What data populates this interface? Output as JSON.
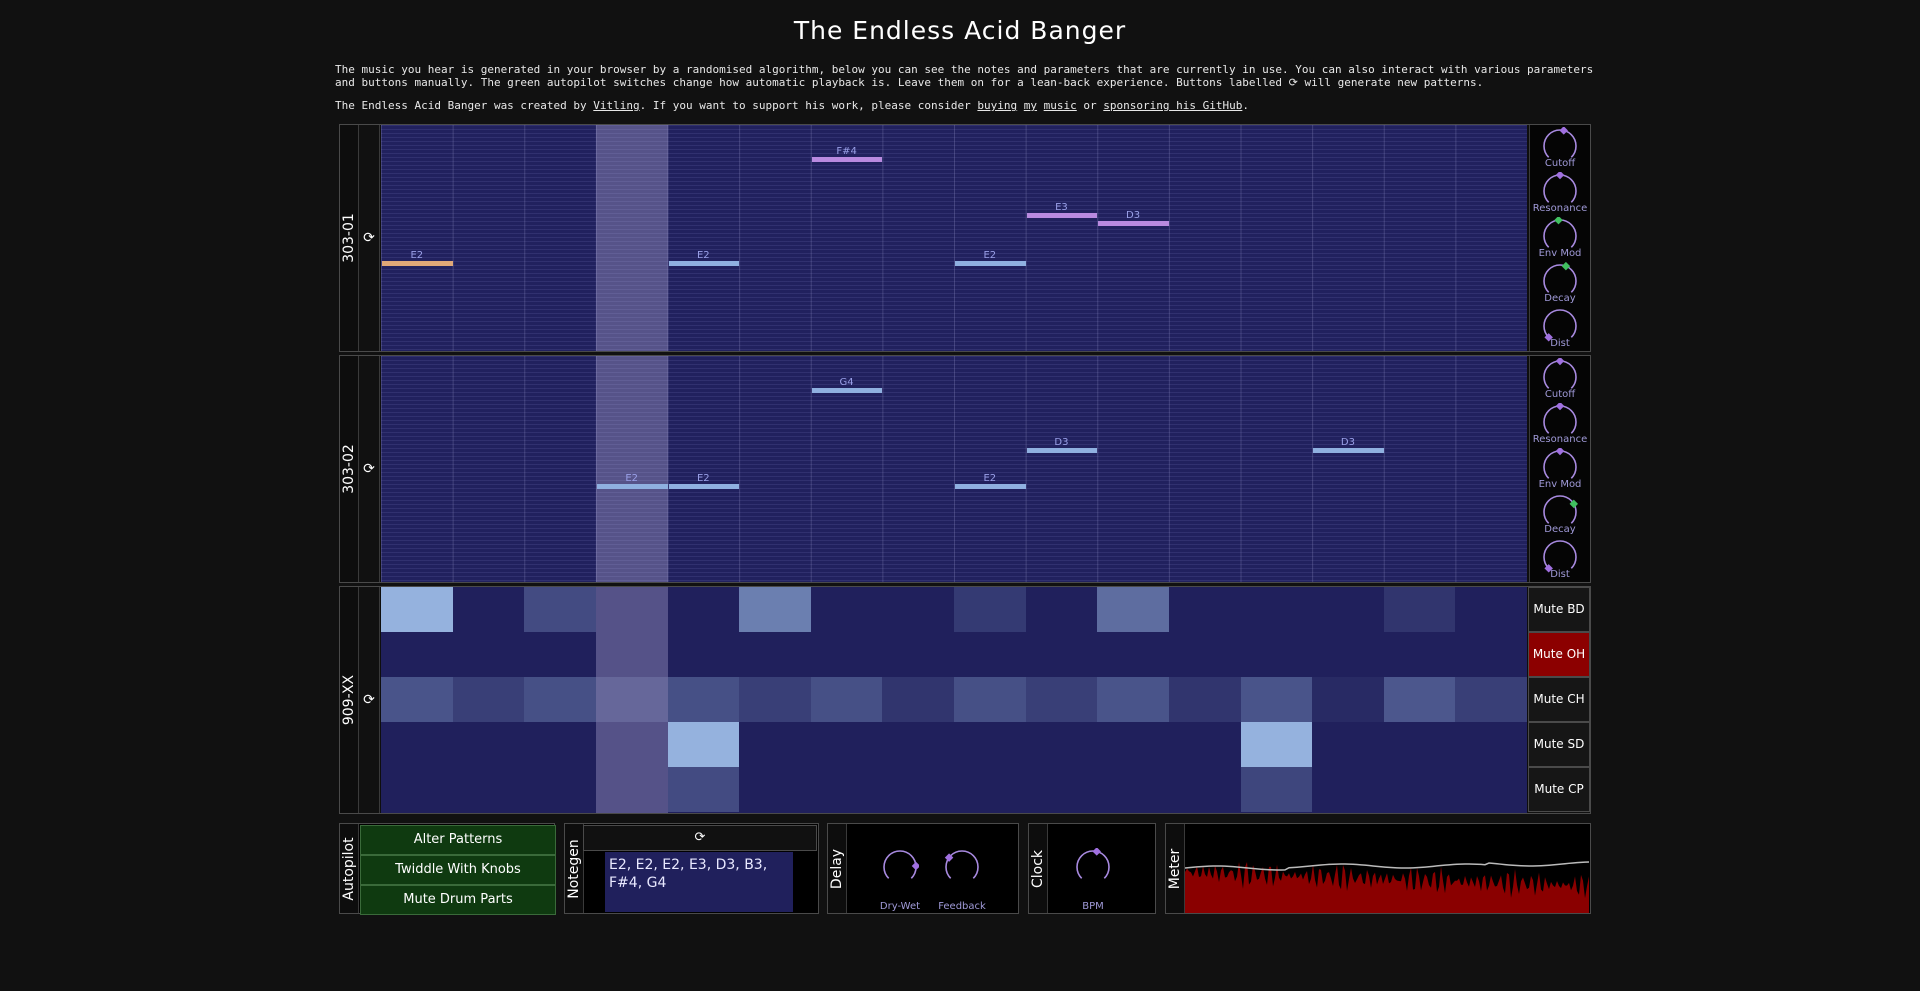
{
  "title": "The Endless Acid Banger",
  "intro": {
    "p1": "The music you hear is generated in your browser by a randomised algorithm, below you can see the notes and parameters that are currently in use. You can also interact with various parameters and buttons manually. The green autopilot switches change how automatic playback is. Leave them on for a lean-back experience. Buttons labelled ⟳ will generate new patterns.",
    "p2_a": "The Endless Acid Banger was created by ",
    "link_vitling": "Vitling",
    "p2_b": ". If you want to support his work, please consider ",
    "link_buying": "buying",
    "link_my": "my",
    "link_music": "music",
    "p2_c": " or ",
    "link_github": "sponsoring his GitHub",
    "p2_d": "."
  },
  "regen_symbol": "⟳",
  "colors": {
    "grid_bg": "#21215e",
    "note_blue": "#8fb0e0",
    "note_purple": "#b98ae0",
    "note_orange": "#e0a878",
    "knob_arc": "#a88ae0",
    "knob_dot_purple": "#a070e0",
    "knob_dot_green": "#40c060",
    "mute_active": "#8c0000",
    "autopilot_green": "#0f3a10",
    "meter_red": "#8a0000"
  },
  "synths": [
    {
      "name": "303-01",
      "playhead_step": 3,
      "notes": [
        {
          "label": "E2",
          "step": 0,
          "row": 33,
          "color": "orange"
        },
        {
          "label": "F#4",
          "step": 6,
          "row": 7,
          "color": "purple"
        },
        {
          "label": "E2",
          "step": 4,
          "row": 33,
          "color": "blue"
        },
        {
          "label": "E3",
          "step": 9,
          "row": 21,
          "color": "purple"
        },
        {
          "label": "D3",
          "step": 10,
          "row": 23,
          "color": "purple"
        },
        {
          "label": "E2",
          "step": 8,
          "row": 33,
          "color": "blue"
        }
      ],
      "knobs": [
        {
          "label": "Cutoff",
          "value": 0.55,
          "active": false
        },
        {
          "label": "Resonance",
          "value": 0.5,
          "active": false
        },
        {
          "label": "Env Mod",
          "value": 0.48,
          "active": true
        },
        {
          "label": "Decay",
          "value": 0.58,
          "active": true
        },
        {
          "label": "Dist",
          "value": 0.0,
          "active": false
        }
      ]
    },
    {
      "name": "303-02",
      "playhead_step": 3,
      "notes": [
        {
          "label": "G4",
          "step": 6,
          "row": 7,
          "color": "blue"
        },
        {
          "label": "E2",
          "step": 3,
          "row": 31,
          "color": "blue"
        },
        {
          "label": "E2",
          "step": 4,
          "row": 31,
          "color": "blue"
        },
        {
          "label": "D3",
          "step": 9,
          "row": 22,
          "color": "blue"
        },
        {
          "label": "E2",
          "step": 8,
          "row": 31,
          "color": "blue"
        },
        {
          "label": "D3",
          "step": 13,
          "row": 22,
          "color": "blue"
        }
      ],
      "knobs": [
        {
          "label": "Cutoff",
          "value": 0.5,
          "active": false
        },
        {
          "label": "Resonance",
          "value": 0.5,
          "active": false
        },
        {
          "label": "Env Mod",
          "value": 0.5,
          "active": false
        },
        {
          "label": "Decay",
          "value": 0.72,
          "active": true
        },
        {
          "label": "Dist",
          "value": 0.0,
          "active": false
        }
      ]
    }
  ],
  "drums": {
    "name": "909-XX",
    "playhead_step": 3,
    "rows": [
      [
        0.85,
        0,
        0.25,
        0,
        0,
        0.55,
        0,
        0,
        0.15,
        0,
        0.45,
        0,
        0,
        0,
        0.12,
        0
      ],
      [
        0,
        0,
        0,
        0,
        0,
        0,
        0,
        0,
        0,
        0,
        0,
        0,
        0,
        0,
        0,
        0
      ],
      [
        0.3,
        0.18,
        0.28,
        0.18,
        0.28,
        0.18,
        0.28,
        0.12,
        0.28,
        0.18,
        0.3,
        0.12,
        0.3,
        0.06,
        0.32,
        0.18
      ],
      [
        0,
        0,
        0,
        0,
        0.85,
        0,
        0,
        0,
        0,
        0,
        0,
        0,
        0.85,
        0,
        0,
        0
      ],
      [
        0,
        0,
        0,
        0,
        0.25,
        0,
        0,
        0,
        0,
        0,
        0,
        0,
        0.22,
        0,
        0,
        0
      ]
    ],
    "mutes": [
      {
        "label": "Mute BD",
        "active": false
      },
      {
        "label": "Mute OH",
        "active": true
      },
      {
        "label": "Mute CH",
        "active": false
      },
      {
        "label": "Mute SD",
        "active": false
      },
      {
        "label": "Mute CP",
        "active": false
      }
    ]
  },
  "autopilot": {
    "label": "Autopilot",
    "buttons": [
      "Alter Patterns",
      "Twiddle With Knobs",
      "Mute Drum Parts"
    ]
  },
  "notegen": {
    "label": "Notegen",
    "notes": "E2, E2, E2, E3, D3, B3, F#4, G4"
  },
  "delay": {
    "label": "Delay",
    "knobs": [
      {
        "label": "Dry-Wet",
        "value": 0.82
      },
      {
        "label": "Feedback",
        "value": 0.3
      }
    ]
  },
  "clock": {
    "label": "Clock",
    "knobs": [
      {
        "label": "BPM",
        "value": 0.55
      }
    ]
  },
  "meter": {
    "label": "Meter"
  }
}
